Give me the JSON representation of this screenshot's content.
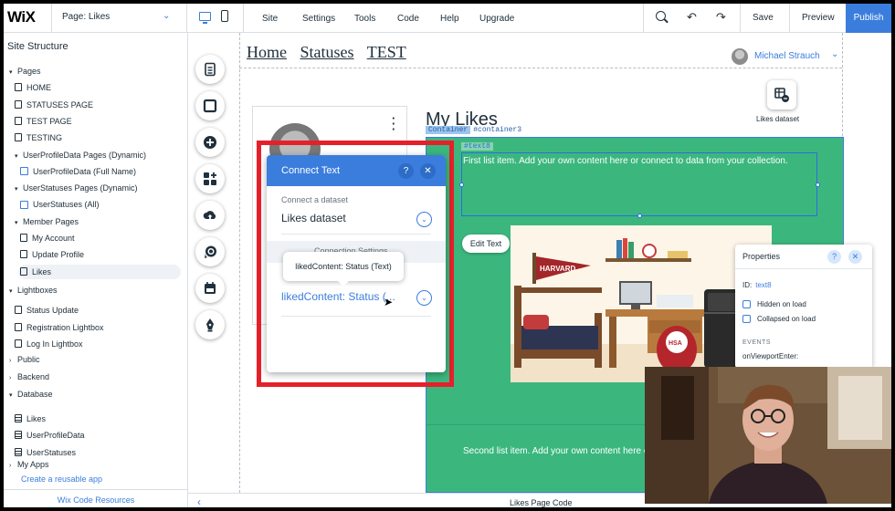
{
  "topbar": {
    "logo": "WiX",
    "page_prefix": "Page:",
    "page_name": "Likes",
    "menu": [
      "Site",
      "Settings",
      "Tools",
      "Code",
      "Help",
      "Upgrade"
    ],
    "save": "Save",
    "preview": "Preview",
    "publish": "Publish"
  },
  "structure": {
    "title": "Site Structure",
    "rows": [
      {
        "label": "Pages",
        "level": 0,
        "caret": "open"
      },
      {
        "label": "HOME",
        "level": 1,
        "icon": "page"
      },
      {
        "label": "STATUSES PAGE",
        "level": 1,
        "icon": "page"
      },
      {
        "label": "TEST PAGE",
        "level": 1,
        "icon": "page"
      },
      {
        "label": "TESTING",
        "level": 1,
        "icon": "page"
      },
      {
        "label": "UserProfileData Pages (Dynamic)",
        "level": 1,
        "caret": "open"
      },
      {
        "label": "UserProfileData (Full Name)",
        "level": 2,
        "icon": "dynamic"
      },
      {
        "label": "UserStatuses Pages (Dynamic)",
        "level": 1,
        "caret": "open"
      },
      {
        "label": "UserStatuses (All)",
        "level": 2,
        "icon": "dynamic"
      },
      {
        "label": "Member Pages",
        "level": 1,
        "caret": "open"
      },
      {
        "label": "My Account",
        "level": 2,
        "icon": "page"
      },
      {
        "label": "Update Profile",
        "level": 2,
        "icon": "page"
      },
      {
        "label": "Likes",
        "level": 2,
        "icon": "page",
        "selected": true
      },
      {
        "label": "Lightboxes",
        "level": 0,
        "caret": "open"
      },
      {
        "label": "Status Update",
        "level": 1,
        "icon": "lightbox"
      },
      {
        "label": "Registration Lightbox",
        "level": 1,
        "icon": "lightbox"
      },
      {
        "label": "Log In Lightbox",
        "level": 1,
        "icon": "lightbox"
      },
      {
        "label": "Public",
        "level": 0,
        "caret": "closed"
      },
      {
        "label": "Backend",
        "level": 0,
        "caret": "closed"
      },
      {
        "label": "Database",
        "level": 0,
        "caret": "open"
      },
      {
        "label": "Likes",
        "level": 1,
        "icon": "grid"
      },
      {
        "label": "UserProfileData",
        "level": 1,
        "icon": "grid"
      },
      {
        "label": "UserStatuses",
        "level": 1,
        "icon": "grid"
      },
      {
        "label": "My Apps",
        "level": 0,
        "caret": "closed"
      }
    ],
    "create_app": "Create a reusable app",
    "resources": "Wix Code Resources"
  },
  "canvas": {
    "nav_links": [
      "Home",
      "Statuses",
      "TEST"
    ],
    "user_name": "Michael Strauch",
    "dataset_label": "Likes dataset",
    "title": "My Likes",
    "container_tag_kind": "Container",
    "container_tag_id": "#container3",
    "text_tag": "#text8",
    "item1_text": "First list item. Add your own content here or connect to data from your collection.",
    "item2_text": "Second list item. Add your own content here o",
    "edit_text": "Edit Text"
  },
  "connect_panel": {
    "title": "Connect Text",
    "dataset_label": "Connect a dataset",
    "dataset_value": "Likes dataset",
    "section_label": "Connection Settings",
    "connection_value": "likedContent: Status (...",
    "tooltip": "likedContent: Status (Text)"
  },
  "properties": {
    "title": "Properties",
    "id_label": "ID:",
    "id_value": "text8",
    "hidden": "Hidden on load",
    "collapsed": "Collapsed on load",
    "events": "EVENTS",
    "event1": "onViewportEnter:"
  },
  "bottom": {
    "title": "Likes Page Code"
  },
  "colors": {
    "accent": "#3b7ddd",
    "repeater": "#3bb77e",
    "highlight": "#e5202a"
  }
}
